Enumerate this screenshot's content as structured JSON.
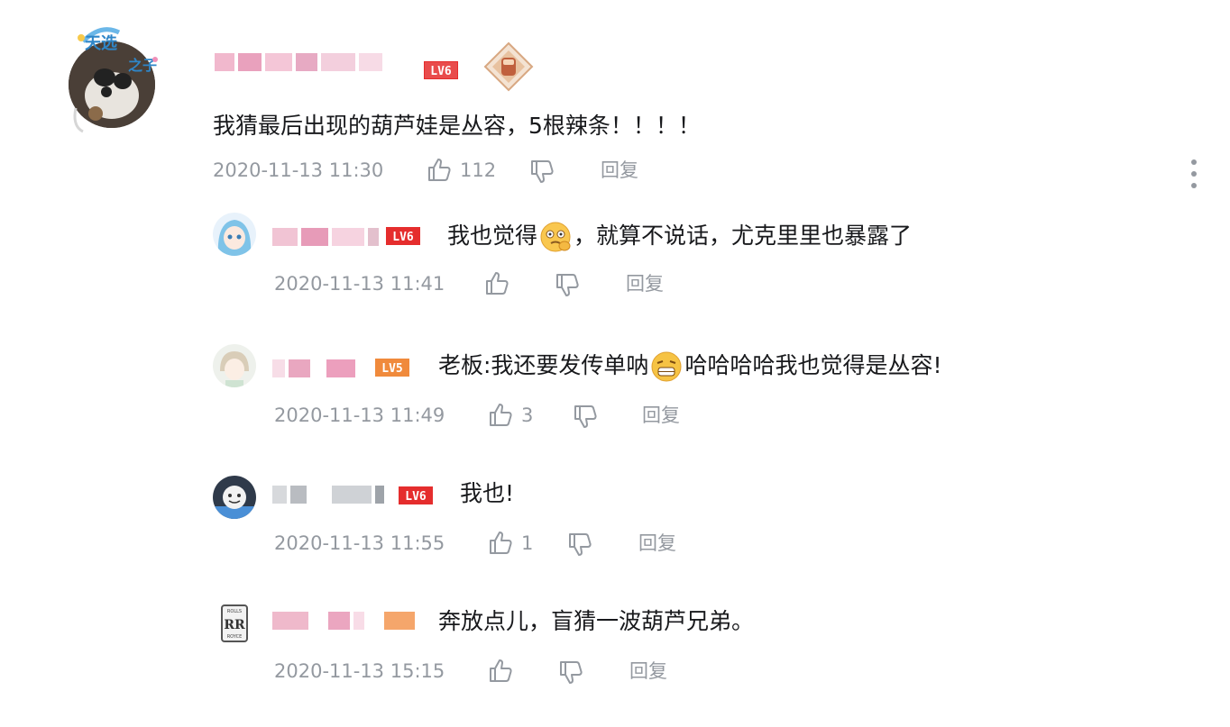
{
  "main_comment": {
    "level": "LV6",
    "text": "我猜最后出现的葫芦娃是丛容，5根辣条！！！！",
    "time": "2020-11-13 11:30",
    "likes": "112",
    "reply_label": "回复",
    "pendant_text": "天选之子"
  },
  "replies": [
    {
      "level": "LV6",
      "text_before": "我也觉得",
      "emoji_1": "thinking-face-emoji",
      "text_after": "，就算不说话，尤克里里也暴露了",
      "time": "2020-11-13 11:41",
      "likes": "",
      "reply_label": "回复"
    },
    {
      "level": "LV5",
      "text_before": "老板:我还要发传单呐",
      "emoji_1": "grinning-face-emoji",
      "text_after": "哈哈哈哈我也觉得是丛容!",
      "time": "2020-11-13 11:49",
      "likes": "3",
      "reply_label": "回复"
    },
    {
      "level": "LV6",
      "text": "我也!",
      "time": "2020-11-13 11:55",
      "likes": "1",
      "reply_label": "回复"
    },
    {
      "level": "",
      "text": "奔放点儿，盲猜一波葫芦兄弟。",
      "time": "2020-11-13 15:15",
      "likes": "",
      "reply_label": "回复"
    }
  ],
  "colors": {
    "meta_gray": "#9499a0",
    "lv6": "#e52d2d",
    "lv5": "#f08a3c",
    "text": "#18191c"
  }
}
